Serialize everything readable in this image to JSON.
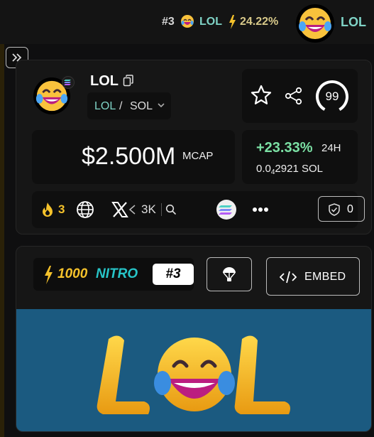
{
  "topbar": {
    "rank": "#3",
    "ticker": "LOL",
    "boost_pct": "24.22%",
    "ticker_right": "LOL"
  },
  "token": {
    "name": "LOL",
    "pair_base": "LOL",
    "pair_sep": "/",
    "pair_quote": "SOL",
    "score": "99",
    "mcap": "$2.500M",
    "mcap_label": "MCAP",
    "change_pct": "+23.33%",
    "change_period": "24H",
    "price_prefix": "0.0",
    "price_zero_count": "4",
    "price_digits": "2921",
    "price_unit": "SOL"
  },
  "social": {
    "fire_count": "3",
    "x_followers": "3K",
    "holders": "0"
  },
  "nitro": {
    "amount": "1000",
    "label": "NITRO",
    "rank": "#3"
  },
  "embed_label": "EMBED",
  "banner_text": "LOL",
  "colors": {
    "teal": "#7fd3c6",
    "gain_green": "#7be0a4",
    "gold": "#f5c22b",
    "banner_bg": "#1b5a80"
  },
  "icons": [
    "laughing-emoji-icon",
    "lightning-bolt-icon",
    "solana-icon",
    "copy-icon",
    "chevron-down-icon",
    "star-icon",
    "share-icon",
    "fire-icon",
    "globe-icon",
    "x-logo-icon",
    "search-icon",
    "solana-logo-icon",
    "more-icon",
    "shield-icon",
    "airdrop-icon",
    "code-icon",
    "expand-icon"
  ]
}
